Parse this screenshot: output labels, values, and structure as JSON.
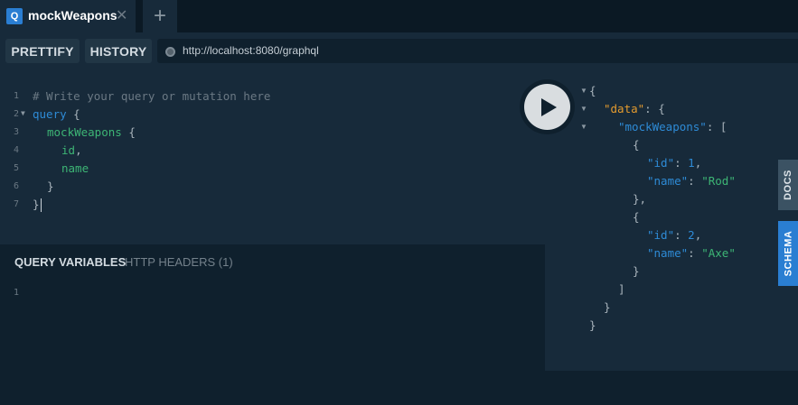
{
  "tab": {
    "badge": "Q",
    "title": "mockWeapons",
    "close": "✕",
    "add": "+"
  },
  "toolbar": {
    "prettify_label": "PRETTIFY",
    "history_label": "HISTORY",
    "url": "http://localhost:8080/graphql"
  },
  "editor": {
    "line_numbers": [
      "1",
      "2",
      "3",
      "4",
      "5",
      "6",
      "7"
    ],
    "comment": "# Write your query or mutation here",
    "keyword": "query",
    "open_brace": "{",
    "field_root": "mockWeapons",
    "field_open": "{",
    "field_id": "id",
    "comma": ",",
    "field_name": "name",
    "close_inner": "}",
    "close_outer": "}"
  },
  "variables": {
    "tab_active": "QUERY VARIABLES",
    "tab_inactive": "HTTP HEADERS (1)",
    "line_number": "1"
  },
  "result": {
    "open": "{",
    "data_key": "\"data\"",
    "colon_open": ": {",
    "root_key": "\"mockWeapons\"",
    "colon_array": ": [",
    "obj_open": "{",
    "id_key": "\"id\"",
    "name_key": "\"name\"",
    "colon": ": ",
    "comma": ",",
    "items": [
      {
        "id": "1",
        "name": "\"Rod\""
      },
      {
        "id": "2",
        "name": "\"Axe\""
      }
    ],
    "obj_close_comma": "},",
    "obj_close": "}",
    "array_close": "]",
    "data_close": "}",
    "close": "}"
  },
  "side_tabs": {
    "docs": "DOCS",
    "schema": "SCHEMA"
  },
  "colors": {
    "accent": "#2a7ed2",
    "background": "#0f202d",
    "panel": "#172a3a"
  },
  "icons": {
    "run": "play-icon",
    "fold": "fold-arrow-icon",
    "endpoint": "status-dot-icon"
  }
}
